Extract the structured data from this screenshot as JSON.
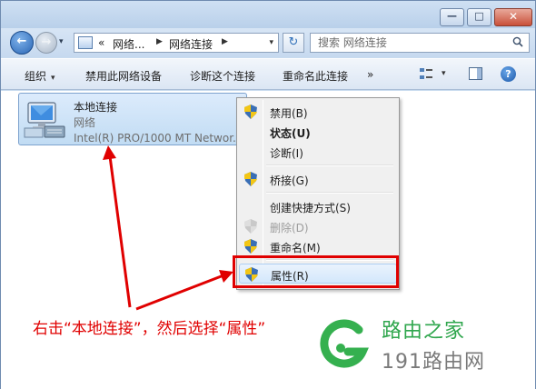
{
  "titlebar": {
    "minimize_glyph": "—",
    "maximize_glyph": "□",
    "close_glyph": "✕"
  },
  "nav": {
    "back_glyph": "←",
    "forward_glyph": "→",
    "dropdown_glyph": "▾",
    "breadcrumb_prefix": "«",
    "crumb1": "网络...",
    "crumb2": "网络连接",
    "crumb_sep": "▶",
    "refresh_glyph": "↻"
  },
  "search": {
    "placeholder": "搜索 网络连接"
  },
  "toolbar": {
    "organize": "组织",
    "disable": "禁用此网络设备",
    "diagnose": "诊断这个连接",
    "rename": "重命名此连接",
    "more": "»",
    "help_glyph": "?"
  },
  "connection": {
    "name": "本地连接",
    "network": "网络",
    "device": "Intel(R) PRO/1000 MT Networ..."
  },
  "context_menu": {
    "items": [
      {
        "label": "禁用(B)"
      },
      {
        "label": "状态(U)"
      },
      {
        "label": "诊断(I)"
      },
      {
        "label": "桥接(G)"
      },
      {
        "label": "创建快捷方式(S)"
      },
      {
        "label": "删除(D)"
      },
      {
        "label": "重命名(M)"
      },
      {
        "label": "属性(R)"
      }
    ]
  },
  "annotation": {
    "caption": "右击“本地连接”，然后选择“属性”",
    "color": "#e00000"
  },
  "watermark": {
    "line1": "路由之家",
    "line2": "191路由网"
  },
  "colors": {
    "accent": "#2a66b5",
    "highlight": "#e00000",
    "watermark_green": "#2fa64d"
  }
}
